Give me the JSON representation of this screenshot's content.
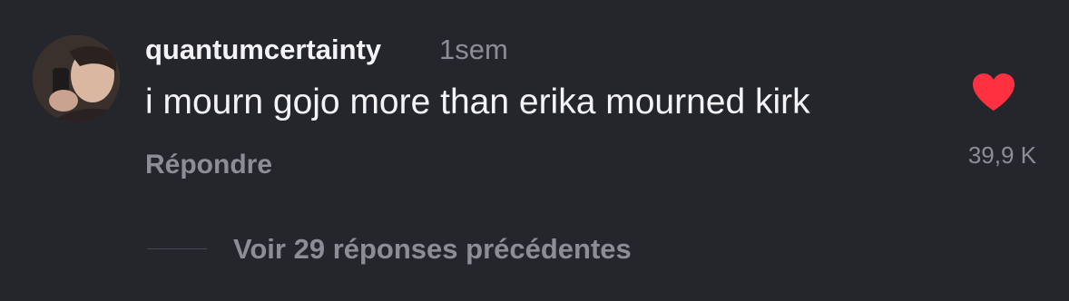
{
  "comment": {
    "avatar_icon": "user-avatar-photo",
    "username": "quantumcertainty",
    "timestamp": "1sem",
    "text": "i mourn gojo more than erika mourned kirk",
    "reply_label": "Répondre",
    "like_icon": "heart-icon",
    "like_color": "#ff3040",
    "like_count": "39,9 K",
    "view_replies_label": "Voir 29 réponses précédentes"
  },
  "colors": {
    "background": "#24262b",
    "primary_text": "#f4f4f6",
    "secondary_text": "#8b8e96"
  }
}
